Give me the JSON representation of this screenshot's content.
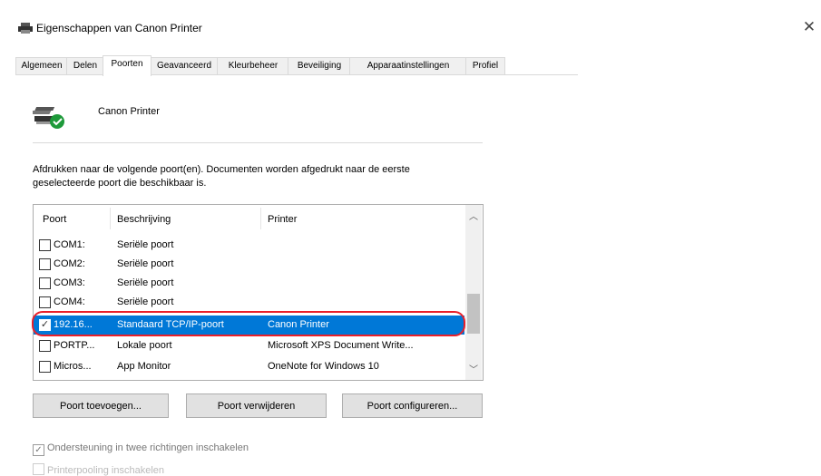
{
  "window": {
    "title": "Eigenschappen van Canon Printer",
    "close_glyph": "✕"
  },
  "tabs": [
    {
      "label": "Algemeen"
    },
    {
      "label": "Delen"
    },
    {
      "label": "Poorten"
    },
    {
      "label": "Geavanceerd"
    },
    {
      "label": "Kleurbeheer"
    },
    {
      "label": "Beveiliging"
    },
    {
      "label": "Apparaatinstellingen"
    },
    {
      "label": "Profiel"
    }
  ],
  "printer": {
    "name": "Canon Printer"
  },
  "description": "Afdrukken naar de volgende poort(en). Documenten worden afgedrukt naar de eerste geselecteerde poort die beschikbaar is.",
  "ports": {
    "headers": {
      "port": "Poort",
      "description": "Beschrijving",
      "printer": "Printer"
    },
    "rows": [
      {
        "port": "COM1:",
        "description": "Seriële poort",
        "printer": "",
        "checked": false,
        "selected": false
      },
      {
        "port": "COM2:",
        "description": "Seriële poort",
        "printer": "",
        "checked": false,
        "selected": false
      },
      {
        "port": "COM3:",
        "description": "Seriële poort",
        "printer": "",
        "checked": false,
        "selected": false
      },
      {
        "port": "COM4:",
        "description": "Seriële poort",
        "printer": "",
        "checked": false,
        "selected": false
      },
      {
        "port": "192.16...",
        "description": "Standaard TCP/IP-poort",
        "printer": "Canon Printer",
        "checked": true,
        "selected": true
      },
      {
        "port": "PORTP...",
        "description": "Lokale poort",
        "printer": "Microsoft XPS Document Write...",
        "checked": false,
        "selected": false
      },
      {
        "port": "Micros...",
        "description": "App Monitor",
        "printer": "OneNote for Windows 10",
        "checked": false,
        "selected": false
      }
    ]
  },
  "buttons": {
    "add": "Poort toevoegen...",
    "delete": "Poort verwijderen",
    "configure": "Poort configureren..."
  },
  "options": {
    "bidirectional": "Ondersteuning in twee richtingen inschakelen",
    "pooling": "Printerpooling inschakelen"
  },
  "colors": {
    "selection": "#0078d7",
    "highlight_ring": "#e8202a"
  }
}
